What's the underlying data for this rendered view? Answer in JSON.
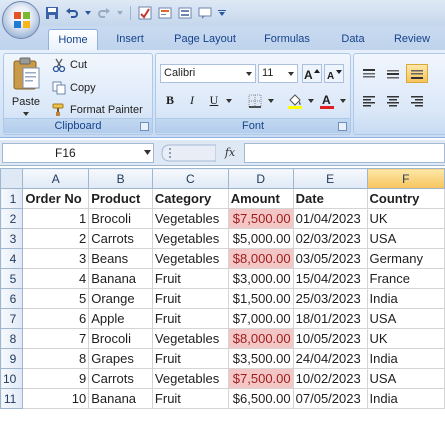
{
  "ribbon_tabs": [
    "Home",
    "Insert",
    "Page Layout",
    "Formulas",
    "Data",
    "Review"
  ],
  "clipboard": {
    "paste_label": "Paste",
    "cut_label": "Cut",
    "copy_label": "Copy",
    "format_painter_label": "Format Painter",
    "group_label": "Clipboard"
  },
  "font": {
    "family": "Calibri",
    "size": "11",
    "bold_label": "B",
    "italic_label": "I",
    "underline_label": "U",
    "group_label": "Font"
  },
  "formula_bar": {
    "name_box": "F16",
    "fx_label": "fx",
    "formula": ""
  },
  "columns": [
    "A",
    "B",
    "C",
    "D",
    "E",
    "F"
  ],
  "selected_column": "F",
  "rows": [
    {
      "n": "1",
      "cells": [
        "Order No",
        "Product",
        "Category",
        "Amount",
        "Date",
        "Country"
      ]
    },
    {
      "n": "2",
      "cells": [
        "1",
        "Brocoli",
        "Vegetables",
        "$7,500.00",
        "01/04/2023",
        "UK"
      ]
    },
    {
      "n": "3",
      "cells": [
        "2",
        "Carrots",
        "Vegetables",
        "$5,000.00",
        "02/03/2023",
        "USA"
      ]
    },
    {
      "n": "4",
      "cells": [
        "3",
        "Beans",
        "Vegetables",
        "$8,000.00",
        "03/05/2023",
        "Germany"
      ]
    },
    {
      "n": "5",
      "cells": [
        "4",
        "Banana",
        "Fruit",
        "$3,000.00",
        "15/04/2023",
        "France"
      ]
    },
    {
      "n": "6",
      "cells": [
        "5",
        "Orange",
        "Fruit",
        "$1,500.00",
        "25/03/2023",
        "India"
      ]
    },
    {
      "n": "7",
      "cells": [
        "6",
        "Apple",
        "Fruit",
        "$7,000.00",
        "18/01/2023",
        "USA"
      ]
    },
    {
      "n": "8",
      "cells": [
        "7",
        "Brocoli",
        "Vegetables",
        "$8,000.00",
        "10/05/2023",
        "UK"
      ]
    },
    {
      "n": "9",
      "cells": [
        "8",
        "Grapes",
        "Fruit",
        "$3,500.00",
        "24/04/2023",
        "India"
      ]
    },
    {
      "n": "10",
      "cells": [
        "9",
        "Carrots",
        "Vegetables",
        "$7,500.00",
        "10/02/2023",
        "USA"
      ]
    },
    {
      "n": "11",
      "cells": [
        "10",
        "Banana",
        "Fruit",
        "$6,500.00",
        "07/05/2023",
        "India"
      ]
    }
  ],
  "highlighted_amount_rows": [
    "2",
    "4",
    "8",
    "10"
  ],
  "colors": {
    "highlight_fill": "#f4c6c6",
    "highlight_text": "#9c1c1c",
    "ribbon_text": "#15428b",
    "selected_column_header": "#f7c45c"
  }
}
